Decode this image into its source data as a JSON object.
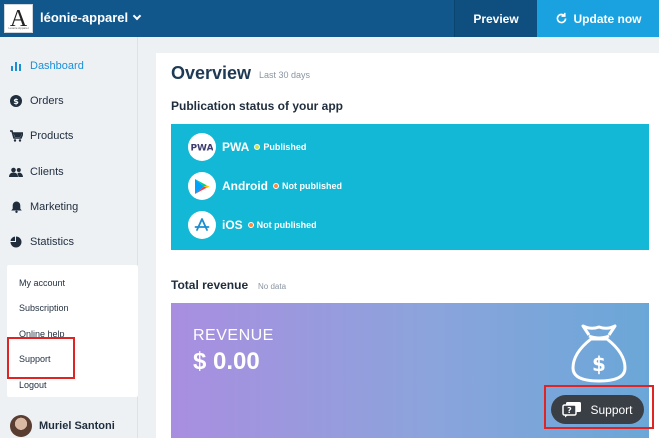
{
  "topbar": {
    "logo_letter": "A",
    "logo_small": "Léonie Apparel",
    "app_name": "léonie-apparel",
    "preview_label": "Preview",
    "update_label": "Update now"
  },
  "sidebar": {
    "items": [
      {
        "label": "Dashboard",
        "icon": "bar-chart-icon",
        "active": true
      },
      {
        "label": "Orders",
        "icon": "dollar-circle-icon"
      },
      {
        "label": "Products",
        "icon": "cart-icon"
      },
      {
        "label": "Clients",
        "icon": "users-icon"
      },
      {
        "label": "Marketing",
        "icon": "bell-icon"
      },
      {
        "label": "Statistics",
        "icon": "pie-chart-icon"
      }
    ],
    "menu": [
      "My account",
      "Subscription",
      "Online help",
      "Support",
      "Logout"
    ],
    "user_name": "Muriel Santoni"
  },
  "main": {
    "overview_title": "Overview",
    "overview_subtitle": "Last 30 days",
    "publication_title": "Publication status of your app",
    "platforms": [
      {
        "name": "PWA",
        "status": "Published",
        "status_color": "#c7e34a",
        "icon": "pwa-icon"
      },
      {
        "name": "Android",
        "status": "Not published",
        "status_color": "#ff8a3d",
        "icon": "google-play-icon"
      },
      {
        "name": "iOS",
        "status": "Not published",
        "status_color": "#ff8a3d",
        "icon": "app-store-icon"
      }
    ],
    "revenue_title": "Total revenue",
    "revenue_subtitle": "No data",
    "revenue_label": "REVENUE",
    "revenue_value": "$ 0.00"
  },
  "support_button": {
    "label": "Support",
    "icon": "chat-question-icon"
  },
  "colors": {
    "topbar": "#12578c",
    "accent": "#1aa2e0",
    "publication_card": "#12b8d5",
    "highlight": "#e02424"
  }
}
